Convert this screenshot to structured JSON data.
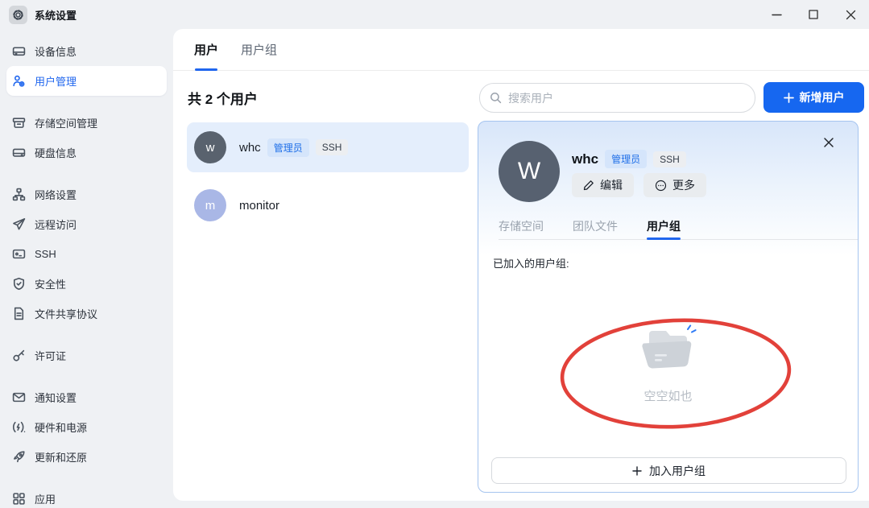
{
  "window": {
    "title": "系统设置"
  },
  "sidebar": {
    "items": [
      {
        "label": "设备信息"
      },
      {
        "label": "用户管理"
      },
      {
        "label": "存储空间管理"
      },
      {
        "label": "硬盘信息"
      },
      {
        "label": "网络设置"
      },
      {
        "label": "远程访问"
      },
      {
        "label": "SSH"
      },
      {
        "label": "安全性"
      },
      {
        "label": "文件共享协议"
      },
      {
        "label": "许可证"
      },
      {
        "label": "通知设置"
      },
      {
        "label": "硬件和电源"
      },
      {
        "label": "更新和还原"
      },
      {
        "label": "应用"
      }
    ],
    "active_item": "用户管理"
  },
  "main": {
    "tabs": [
      {
        "label": "用户",
        "active": true
      },
      {
        "label": "用户组",
        "active": false
      }
    ],
    "user_count_text": "共 2 个用户",
    "search_placeholder": "搜索用户",
    "add_user_label": "新增用户",
    "users": [
      {
        "name": "whc",
        "avatar_letter": "w",
        "badges": [
          "管理员",
          "SSH"
        ],
        "selected": true
      },
      {
        "name": "monitor",
        "avatar_letter": "m",
        "badges": [],
        "selected": false
      }
    ]
  },
  "detail_panel": {
    "avatar_letter": "W",
    "name": "whc",
    "badges": [
      "管理员",
      "SSH"
    ],
    "edit_label": "编辑",
    "more_label": "更多",
    "tabs": [
      {
        "label": "存储空间",
        "active": false
      },
      {
        "label": "团队文件",
        "active": false
      },
      {
        "label": "用户组",
        "active": true
      }
    ],
    "joined_groups_label": "已加入的用户组:",
    "empty_state_text": "空空如也",
    "join_group_label": "加入用户组"
  },
  "icons": {
    "gear": "settings-gear",
    "search": "magnifier",
    "plus": "plus-cross",
    "edit": "pencil",
    "more": "circle-ellipsis",
    "close": "x-cross",
    "minimize": "horizontal-bar",
    "maximize": "square",
    "empty_folder": "open-folder-with-sparkles",
    "annotation": "red-ellipse-highlight"
  },
  "colors": {
    "accent": "#2066ee",
    "add_button": "#1667f0",
    "selected_row_bg": "#e4eefc",
    "card_border": "#a5c4ef",
    "card_gradient_top": "#d8e6fa",
    "annotation_red": "#e2413a",
    "admin_badge_bg": "#d5e5fb",
    "admin_badge_text": "#1f6fe8",
    "ssh_badge_bg": "#eceef1",
    "avatar_dark": "#59626e",
    "avatar_light": "#a9b7e6",
    "sidebar_bg": "#eff1f4"
  }
}
